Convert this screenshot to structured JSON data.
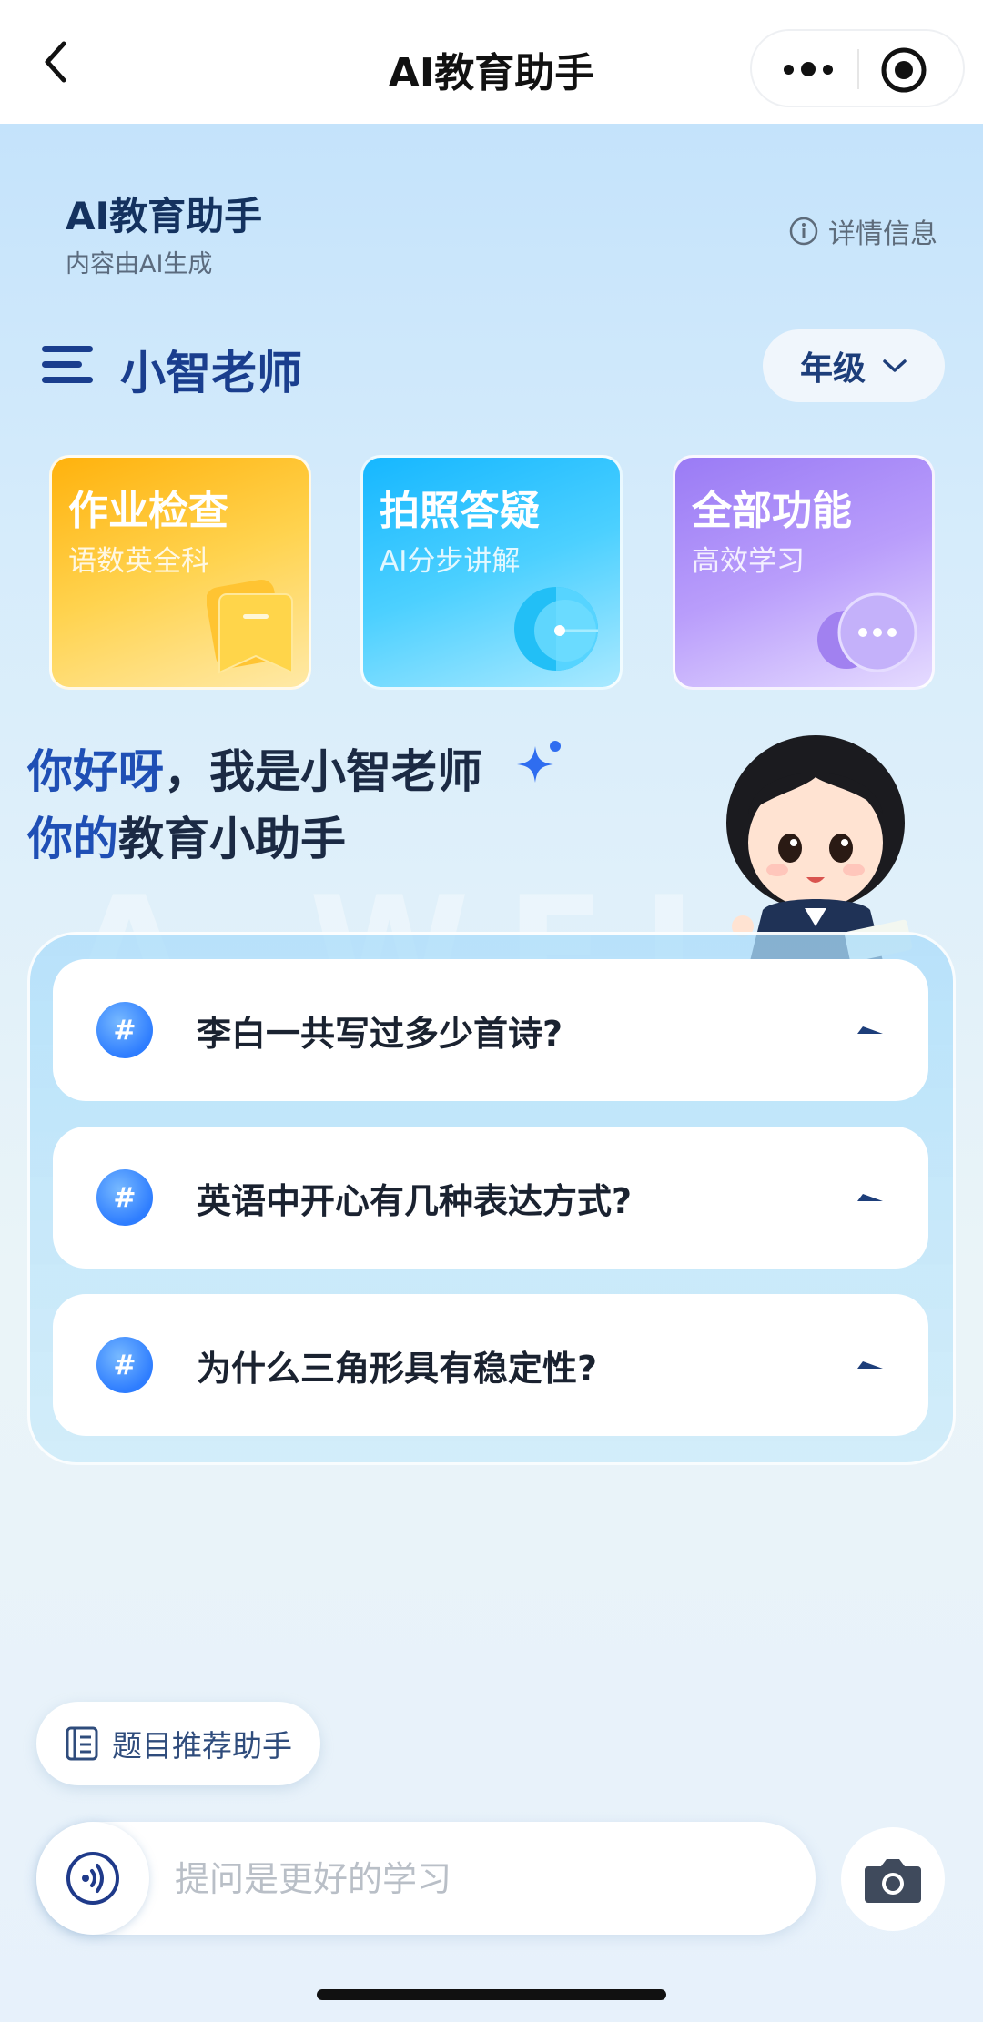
{
  "nav": {
    "title": "AI教育助手",
    "back_icon": "chevron-left-icon",
    "more_icon": "more-dots-icon",
    "close_icon": "target-circle-icon"
  },
  "header": {
    "app_name": "AI教育助手",
    "subtitle": "内容由AI生成",
    "details_label": "详情信息",
    "details_icon": "info-icon"
  },
  "teacher": {
    "name": "小智老师",
    "menu_icon": "menu-lines-icon",
    "grade_label": "年级"
  },
  "cards": [
    {
      "title": "作业检查",
      "subtitle": "语数英全科",
      "color": "#ffb20d",
      "icon": "bookmark-icon"
    },
    {
      "title": "拍照答疑",
      "subtitle": "AI分步讲解",
      "color": "#16b7ff",
      "icon": "lens-icon"
    },
    {
      "title": "全部功能",
      "subtitle": "高效学习",
      "color": "#9a7bf5",
      "icon": "chat-bubble-icon"
    }
  ],
  "greeting": {
    "line1_lead": "你好呀",
    "line1_rest": "，我是小智老师",
    "line2_lead": "你的",
    "line2_rest": "教育小助手",
    "watermark": "A WEI"
  },
  "questions": [
    {
      "badge": "#",
      "text": "李白一共写过多少首诗?"
    },
    {
      "badge": "#",
      "text": "英语中开心有几种表达方式?"
    },
    {
      "badge": "#",
      "text": "为什么三角形具有稳定性?"
    }
  ],
  "bottom": {
    "recommend_label": "题目推荐助手",
    "input_placeholder": "提问是更好的学习",
    "voice_icon": "voice-wave-icon",
    "camera_icon": "camera-icon"
  },
  "colors": {
    "accent": "#1f4fb5",
    "card_yellow": "#ffb20d",
    "card_blue": "#16b7ff",
    "card_purple": "#9a7bf5"
  }
}
